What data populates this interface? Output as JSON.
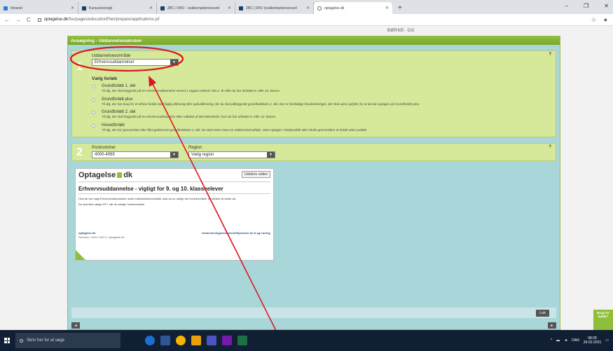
{
  "browser": {
    "tabs": [
      {
        "label": "Intranet",
        "color": "#2e7cd6"
      },
      {
        "label": "Kursusoversigt",
        "color": "#1d3e6e"
      },
      {
        "label": "ZBC | RKV - realkompetencevurd",
        "color": "#1d3e6e"
      },
      {
        "label": "ZBC | RKV (realkompetencevurd",
        "color": "#1d3e6e"
      },
      {
        "label": "optagelse.dk",
        "color": "#5f6368"
      }
    ],
    "new_tab": "+",
    "url_host": "optagelse.dk",
    "url_path": "/fsu/pages/educationPlan/prepare/applications.jsf"
  },
  "page": {
    "top_logo": "BØRNE- OG",
    "header_title": "Ansøgning - Uddannelsesønsker",
    "section1": {
      "number": "1",
      "help": "?",
      "field_label": "Uddannelsesområde",
      "field_value": "Erhvervsuddannelser",
      "choose_label": "Vælg forløb",
      "options": [
        {
          "title": "Grundforløb 1. del",
          "desc": "Til dig, der skal begynde på en erhvervsuddannelse senest 1 august måned i det 2. år efter du har afsluttet 9. eller 10. klasse."
        },
        {
          "title": "Grundforløb plus",
          "desc": "Til dig, der har brug for et ekstra forløb med faglig afklaring eller opkvalificering, før du skal påbegynde grundforløbets 2. del. Der er forskellige forudsætninger, der skal være opfyldt, for at du kan optages på Grundforløb plus."
        },
        {
          "title": "Grundforløb 2. del",
          "desc": "Til dig, der skal begynde på en erhvervsuddannelse efter udløbet af det kalenderår, hvor du har afsluttet 9. eller 10. klasse."
        },
        {
          "title": "Hovedforløb",
          "desc": "Til dig, der har gennemført eller fået godskrevet grundforløbets 2. del. Du skal enten have en uddannelsesaftale, være optaget i skolepraktik eller skulle gennemføre et forløb uden praktik."
        }
      ]
    },
    "section2": {
      "number": "2",
      "help": "?",
      "postal_label": "Postnummer",
      "postal_value": "4000-4999",
      "region_label": "Region",
      "region_value": "Vælg region"
    },
    "card": {
      "logo_left": "Optagelse",
      "logo_right": "dk",
      "print": "Udskriv siden",
      "title": "Erhvervsuddannelse - vigtigt for 9. og 10. klasseelever",
      "p1": "Hvis du har valgt Erhvervsuddannelser under Uddannelsesområde, skal du nu vælge det hovedområde, du ønsker at starte på.",
      "p2": "Du skal ikke vælge GF+ når du vælger hovedområde.",
      "footer_left": "optagelse.dk",
      "footer_revision": "Revision: 15/01 2020 © optagelse.dk",
      "footer_right": "Undervisningsministeriet/Styrelsen for It og Læring"
    },
    "close_button": "Luk",
    "prev_arrow": "◄",
    "next_arrow": "►",
    "help_widget": "Brug for hjælp?"
  },
  "taskbar": {
    "search_placeholder": "Skriv her for at søge",
    "lang": "DAN",
    "time": "08:28",
    "date": "26-02-2021"
  },
  "colors": {
    "accent_green": "#8fbf3a",
    "panel_green": "#d6e89a",
    "panel_teal": "#a9d7d9",
    "annotation_red": "#e0141e"
  }
}
